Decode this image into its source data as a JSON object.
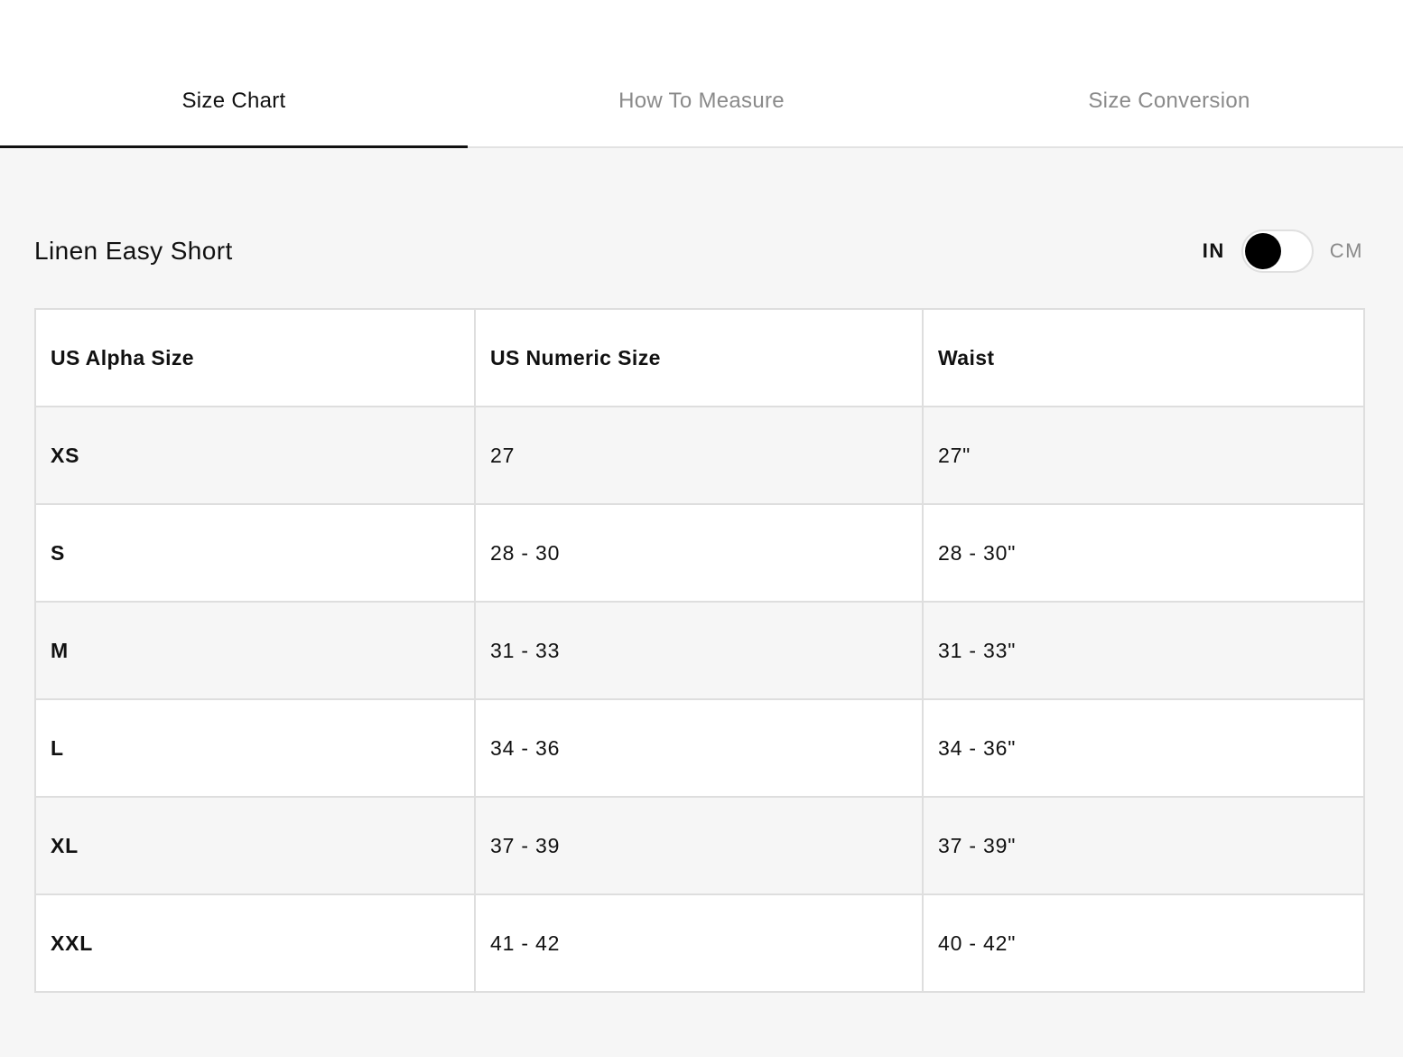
{
  "tabs": [
    {
      "label": "Size Chart",
      "active": true
    },
    {
      "label": "How To Measure",
      "active": false
    },
    {
      "label": "Size Conversion",
      "active": false
    }
  ],
  "product": {
    "title": "Linen Easy Short"
  },
  "unit_toggle": {
    "left_label": "IN",
    "right_label": "CM",
    "selected": "IN"
  },
  "table": {
    "headers": [
      "US Alpha Size",
      "US Numeric Size",
      "Waist"
    ],
    "rows": [
      [
        "XS",
        "27",
        "27\""
      ],
      [
        "S",
        "28 - 30",
        "28 - 30\""
      ],
      [
        "M",
        "31 - 33",
        "31 - 33\""
      ],
      [
        "L",
        "34 - 36",
        "34 - 36\""
      ],
      [
        "XL",
        "37 - 39",
        "37 - 39\""
      ],
      [
        "XXL",
        "41 - 42",
        "40 - 42\""
      ]
    ]
  },
  "colors": {
    "text": "#111111",
    "muted": "#8a8a8a",
    "background": "#f6f6f6",
    "border": "#dedede",
    "accent": "#000000"
  }
}
